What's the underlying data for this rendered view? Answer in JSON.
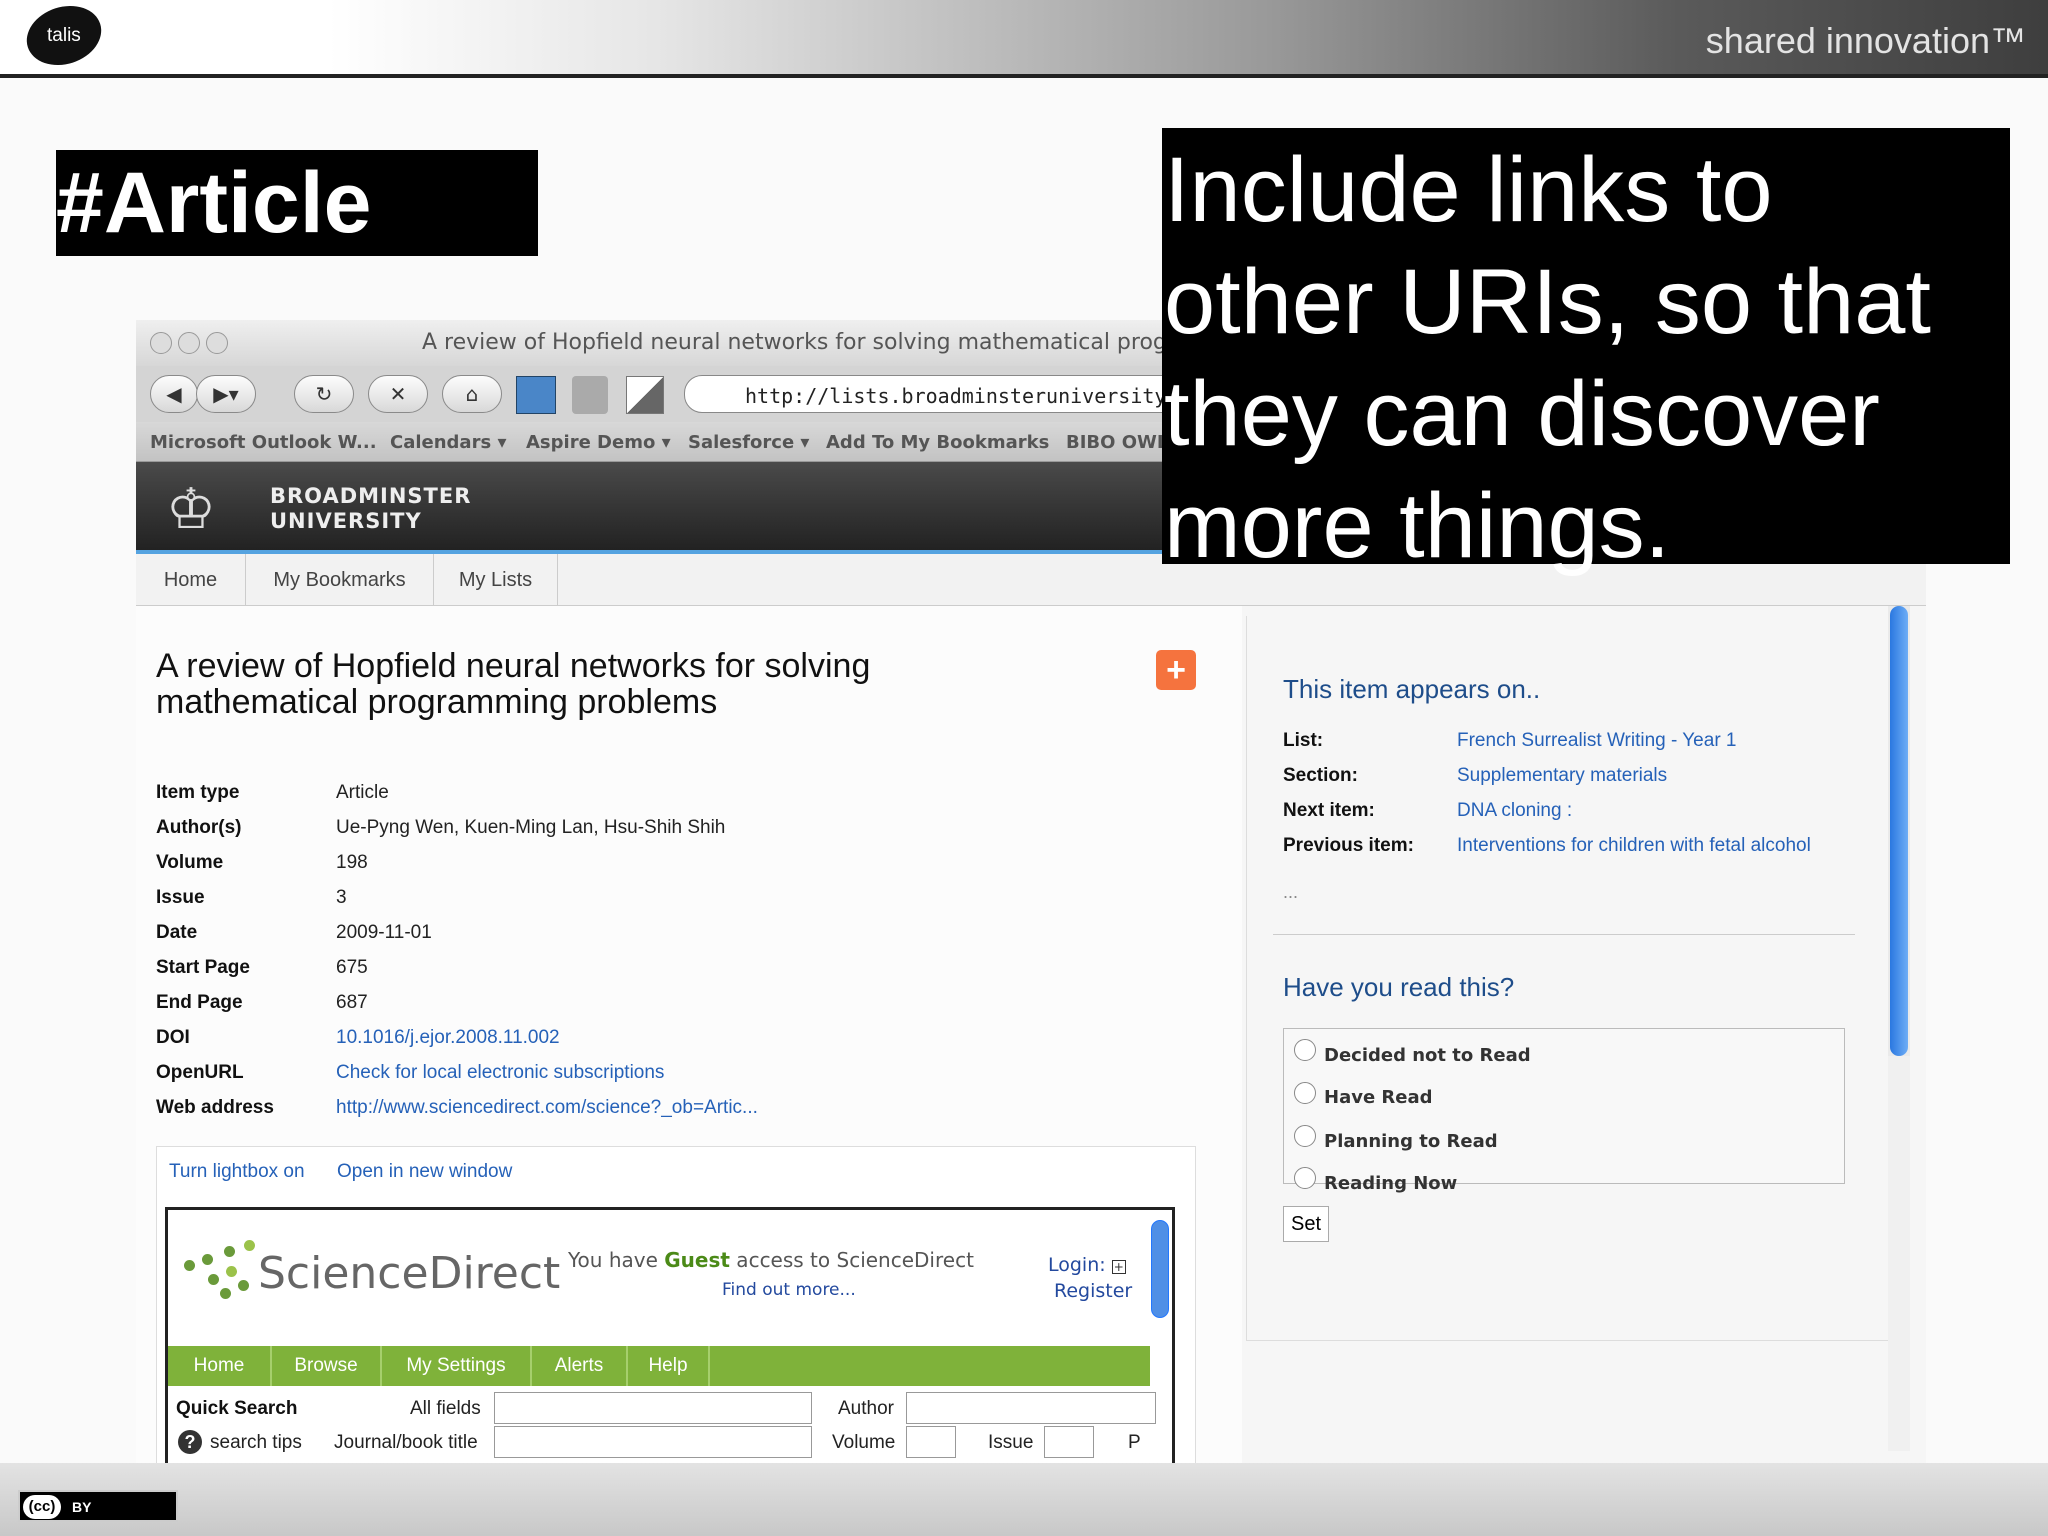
{
  "slide": {
    "logo_text": "talis",
    "tagline": "shared innovation™",
    "title": "#Article",
    "callout": [
      "Include links to",
      "other URIs, so that",
      "they can discover",
      "more things."
    ],
    "license": {
      "icon_text": "(cc)",
      "label": "BY"
    }
  },
  "browser": {
    "window_title": "A review of Hopfield neural networks for solving mathematical progra",
    "address": "http://lists.broadminsteruniversity.org/it",
    "bookmarks": [
      "Microsoft Outlook W...",
      "Calendars ▾",
      "Aspire Demo ▾",
      "Salesforce ▾",
      "Add To My Bookmarks",
      "BIBO OWL"
    ]
  },
  "site": {
    "university": [
      "BROADMINSTER",
      "UNIVERSITY"
    ],
    "nav": [
      "Home",
      "My Bookmarks",
      "My Lists"
    ]
  },
  "item": {
    "title_lines": [
      "A review of Hopfield neural networks for solving",
      "mathematical programming problems"
    ],
    "fields": [
      {
        "label": "Item type",
        "value": "Article"
      },
      {
        "label": "Author(s)",
        "value": "Ue-Pyng Wen, Kuen-Ming Lan, Hsu-Shih Shih"
      },
      {
        "label": "Volume",
        "value": "198"
      },
      {
        "label": "Issue",
        "value": "3"
      },
      {
        "label": "Date",
        "value": "2009-11-01"
      },
      {
        "label": "Start Page",
        "value": "675"
      },
      {
        "label": "End Page",
        "value": "687"
      },
      {
        "label": "DOI",
        "value": "10.1016/j.ejor.2008.11.002"
      },
      {
        "label": "OpenURL",
        "value": "Check for local electronic subscriptions"
      },
      {
        "label": "Web address",
        "value": "http://www.sciencedirect.com/science?_ob=Artic..."
      }
    ]
  },
  "lightbox": {
    "toggle": "Turn lightbox on",
    "open_new": "Open in new window",
    "sd": {
      "logo": "ScienceDirect",
      "access_pre": "You have ",
      "access_guest": "Guest",
      "access_post": " access to ScienceDirect",
      "find_out": "Find out more...",
      "login": "Login:",
      "register": "Register",
      "nav": [
        "Home",
        "Browse",
        "My Settings",
        "Alerts",
        "Help"
      ],
      "quick_search": "Quick Search",
      "all_fields": "All fields",
      "author": "Author",
      "search_tips": "search tips",
      "journal_title": "Journal/book title",
      "volume": "Volume",
      "issue": "Issue",
      "page": "P"
    }
  },
  "sidebar": {
    "appears_heading": "This item appears on..",
    "rows": [
      {
        "label": "List:",
        "value": "French Surrealist Writing - Year 1"
      },
      {
        "label": "Section:",
        "value": "Supplementary materials"
      },
      {
        "label": "Next item:",
        "value": "DNA cloning :"
      },
      {
        "label": "Previous item:",
        "value": "Interventions for children with fetal alcohol"
      }
    ],
    "ellipsis": "...",
    "read_heading": "Have you read this?",
    "options": [
      "Decided not to Read",
      "Have Read",
      "Planning to Read",
      "Reading Now"
    ],
    "set_label": "Set"
  }
}
